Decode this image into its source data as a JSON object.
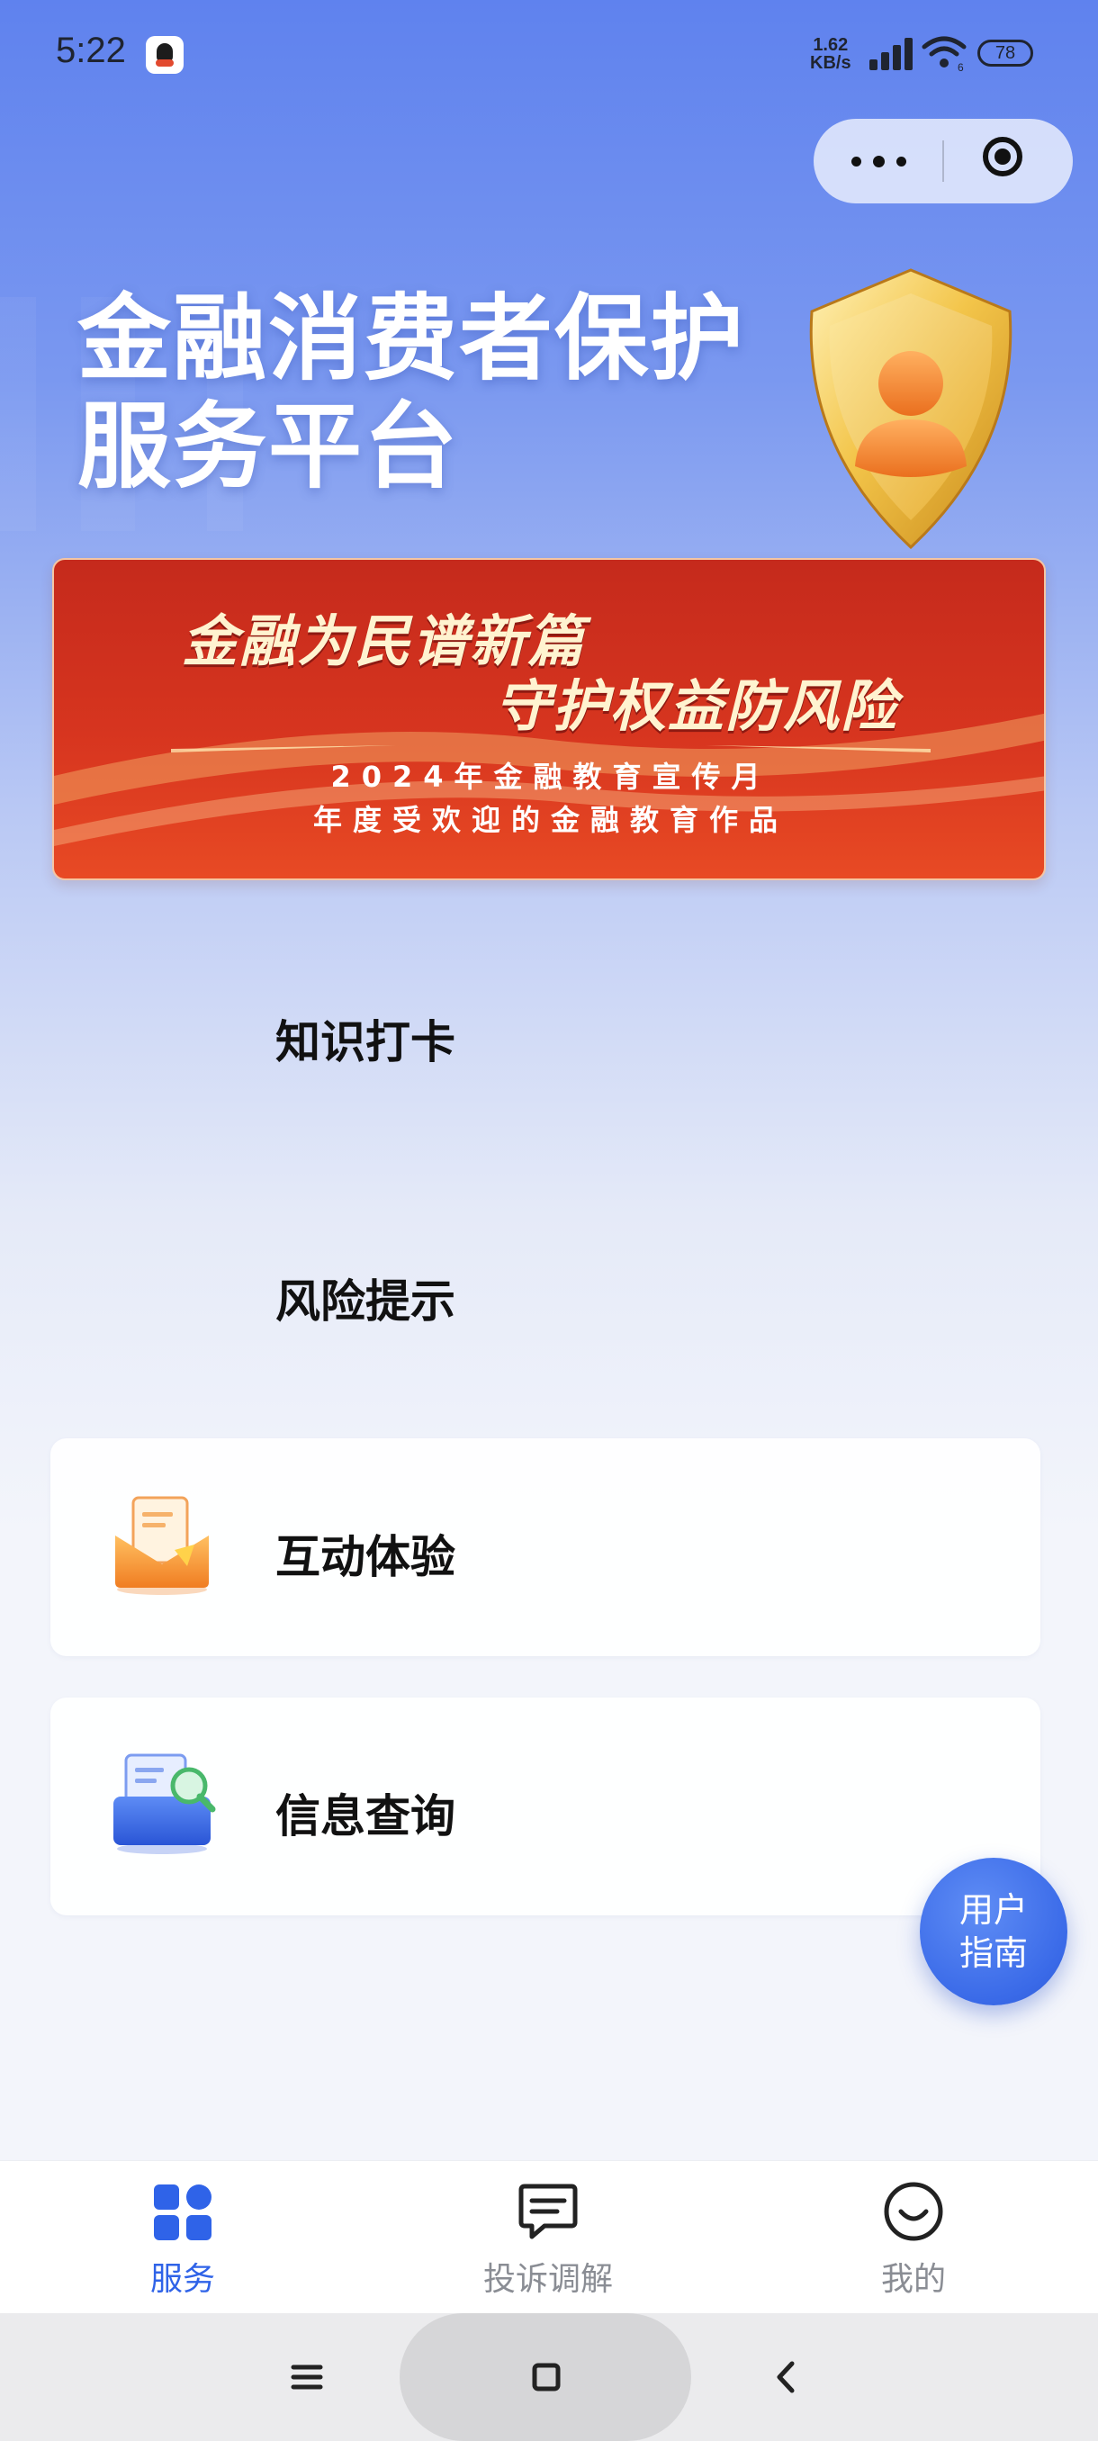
{
  "status_bar": {
    "time": "5:22",
    "net_speed_value": "1.62",
    "net_speed_unit": "KB/s",
    "battery": "78"
  },
  "hero": {
    "title_line1": "金融消费者保护",
    "title_line2": "服务平台"
  },
  "banner": {
    "line1": "金融为民谱新篇",
    "line2": "守护权益防风险",
    "line3": "2024年金融教育宣传月",
    "line4": "年度受欢迎的金融教育作品"
  },
  "menu": {
    "items": [
      {
        "label": "知识打卡"
      },
      {
        "label": "风险提示"
      },
      {
        "label": "互动体验",
        "icon": "envelope-letter-icon"
      },
      {
        "label": "信息查询",
        "icon": "search-folder-icon"
      }
    ]
  },
  "fab": {
    "line1": "用户",
    "line2": "指南"
  },
  "tabbar": {
    "items": [
      {
        "label": "服务",
        "icon": "grid-icon",
        "active": true
      },
      {
        "label": "投诉调解",
        "icon": "chat-bubble-icon",
        "active": false
      },
      {
        "label": "我的",
        "icon": "smile-icon",
        "active": false
      }
    ]
  },
  "colors": {
    "accent": "#2f63e8",
    "banner_red": "#d7351f",
    "tab_inactive": "#8a8d94"
  }
}
